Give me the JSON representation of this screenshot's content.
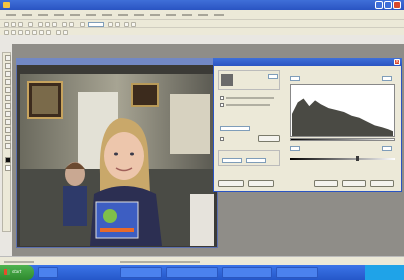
{
  "colors": {
    "xp_blue": "#2a54c2",
    "panel": "#ece9d8",
    "workspace": "#8f8d88",
    "start_green": "#3a9a3a",
    "tray_blue": "#1fa3e8"
  },
  "icons": [
    "app-icon",
    "minimize-icon",
    "maximize-icon",
    "close-icon",
    "windows-logo-icon"
  ],
  "app": {
    "title": ""
  },
  "menu": [
    "",
    "",
    "",
    "",
    "",
    "",
    "",
    "",
    "",
    "",
    "",
    ""
  ],
  "image_window": {
    "title": ""
  },
  "dialog": {
    "title": "",
    "close_label": "×",
    "level_value": "",
    "label_left": "",
    "label_right": "",
    "buttons": {
      "ok": "",
      "cancel": "",
      "help": ""
    }
  },
  "status": {
    "left": "",
    "center": ""
  },
  "taskbar": {
    "start_label": "start",
    "tasks": [
      "",
      "",
      "",
      "",
      ""
    ],
    "clock": ""
  }
}
